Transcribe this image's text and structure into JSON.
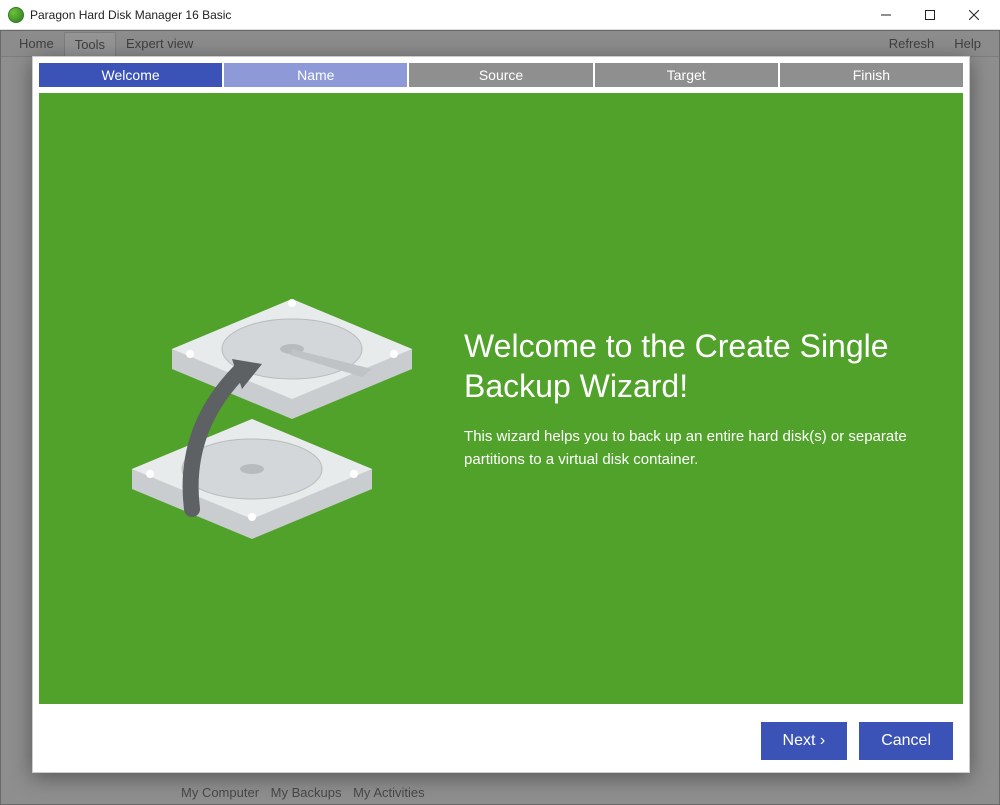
{
  "window": {
    "title": "Paragon Hard Disk Manager 16 Basic"
  },
  "background": {
    "menu": {
      "home": "Home",
      "tools": "Tools",
      "expert": "Expert view",
      "refresh": "Refresh",
      "help": "Help"
    },
    "bottom": {
      "mycomputer": "My Computer",
      "mybackups": "My Backups",
      "myactivities": "My Activities"
    }
  },
  "wizard": {
    "steps": {
      "welcome": "Welcome",
      "name": "Name",
      "source": "Source",
      "target": "Target",
      "finish": "Finish"
    },
    "heading": "Welcome to the Create Single Backup Wizard!",
    "description": "This wizard helps you to back up an entire hard disk(s) or separate partitions to a virtual disk container.",
    "buttons": {
      "next": "Next ›",
      "cancel": "Cancel"
    }
  }
}
